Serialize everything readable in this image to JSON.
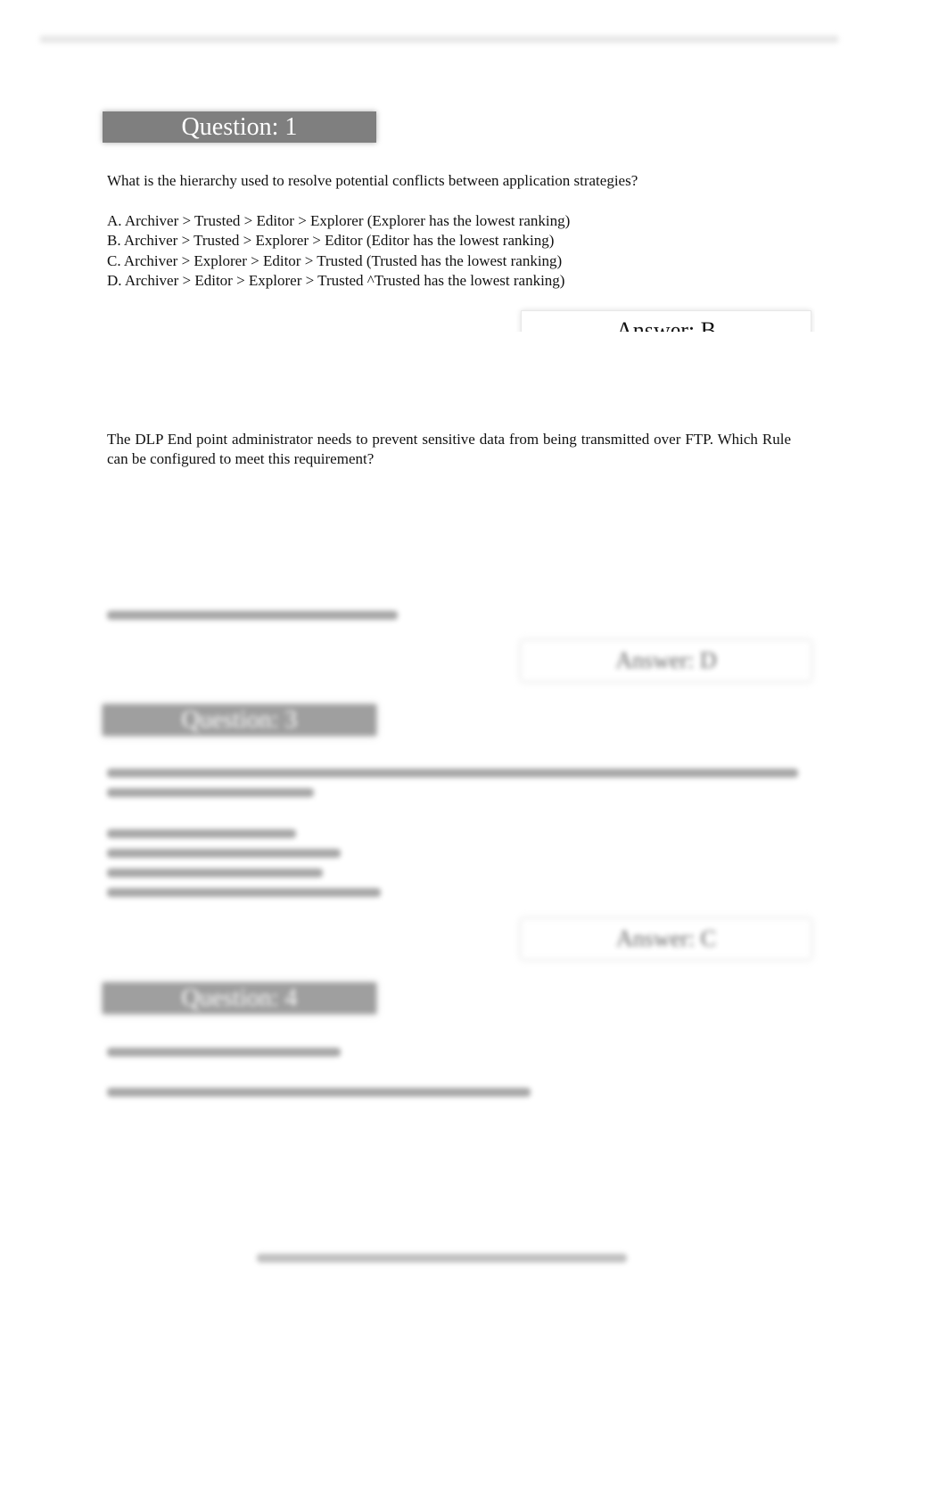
{
  "question1": {
    "header": "Question: 1",
    "text": "What is the hierarchy used to resolve potential conflicts between application strategies?",
    "options": [
      "A. Archiver > Trusted > Editor > Explorer (Explorer has the lowest ranking)",
      "B. Archiver > Trusted > Explorer > Editor (Editor has the lowest ranking)",
      "C. Archiver > Explorer > Editor > Trusted (Trusted has the lowest ranking)",
      "D. Archiver > Editor > Explorer > Trusted ^Trusted has the lowest ranking)"
    ],
    "answer": "Answer: B"
  },
  "question2": {
    "text": "The DLP End point administrator needs to prevent sensitive data from being transmitted over FTP. Which Rule can be configured to meet this requirement?",
    "answer": "Answer: D"
  },
  "question3": {
    "header": "Question: 3",
    "answer": "Answer: C"
  },
  "question4": {
    "header": "Question: 4"
  },
  "colors": {
    "header_bg": "#7f7f7f",
    "header_text": "#ffffff"
  }
}
